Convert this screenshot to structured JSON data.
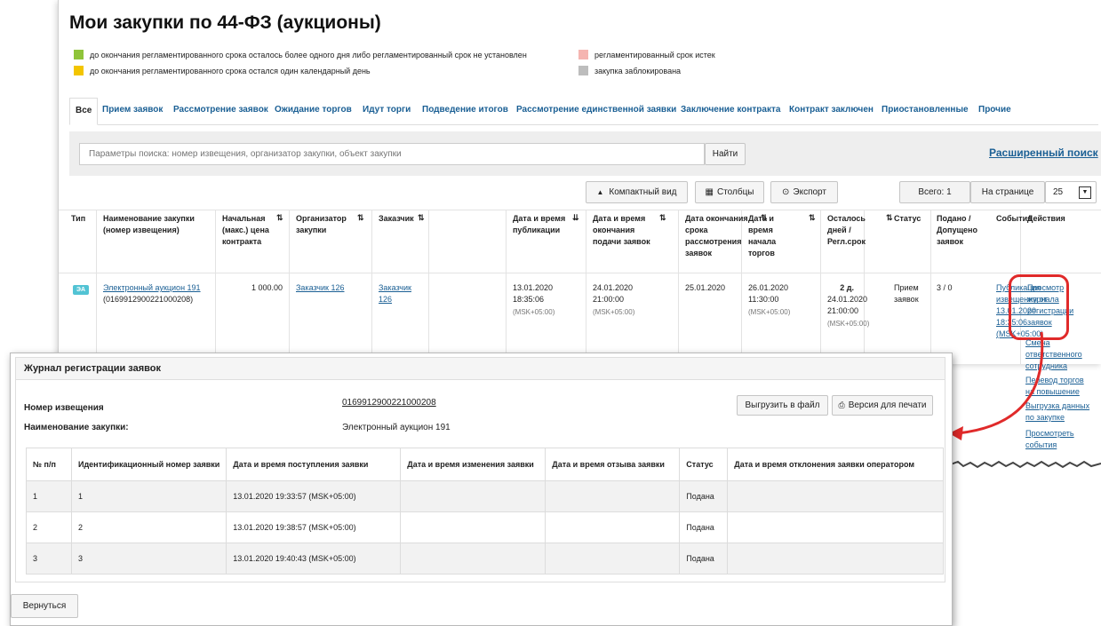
{
  "page": {
    "title": "Мои закупки по 44-ФЗ (аукционы)",
    "legend": [
      {
        "color": "#8fc43a",
        "text": "до окончания регламентированного срока осталось более одного дня либо регламентированный срок не установлен"
      },
      {
        "color": "#f3c500",
        "text": "до окончания регламентированного срока остался один календарный день"
      },
      {
        "color": "#f5b5b1",
        "text": "регламентированный срок истек"
      },
      {
        "color": "#bdbdbd",
        "text": "закупка заблокирована"
      }
    ],
    "tabs": [
      "Все",
      "Прием заявок",
      "Рассмотрение заявок",
      "Ожидание торгов",
      "Идут торги",
      "Подведение итогов",
      "Рассмотрение единственной заявки",
      "Заключение контракта",
      "Контракт заключен",
      "Приостановленные",
      "Прочие"
    ],
    "search": {
      "placeholder": "Параметры поиска: номер извещения, организатор закупки, объект закупки",
      "button": "Найти",
      "advanced": "Расширенный поиск"
    },
    "toolbar": {
      "compact": "Компактный вид",
      "columns": "Столбцы",
      "export": "Экспорт",
      "total": "Всего: 1",
      "per_page_label": "На странице",
      "per_page_value": "25"
    },
    "columns": {
      "type": "Тип",
      "name": "Наименование закупки (номер извещения)",
      "price": "Начальная (макс.) цена контракта",
      "organizer": "Организатор закупки",
      "customer": "Заказчик",
      "pub_date": "Дата и время публикации",
      "end_date": "Дата и время окончания подачи заявок",
      "review_date": "Дата окончания срока рассмотрения заявок",
      "start_date": "Дата и время начала торгов",
      "remaining": "Осталось дней / Регл.срок",
      "status": "Статус",
      "submitted": "Подано / Допущено заявок",
      "events": "События",
      "actions": "Действия"
    },
    "sort_icon": "⇅",
    "sort_icon_active": "⇊",
    "row": {
      "type_badge": "ЭА",
      "name": "Электронный аукцион 191",
      "notice": "(0169912900221000208)",
      "price": "1 000.00",
      "organizer": "Заказчик 126",
      "customer_1": "Заказчик",
      "customer_2": "126",
      "pub_date": "13.01.2020",
      "pub_time": "18:35:06",
      "pub_tz": "(MSK+05:00)",
      "end_date": "24.01.2020",
      "end_time": "21:00:00",
      "end_tz": "(MSK+05:00)",
      "review_date": "25.01.2020",
      "start_date": "26.01.2020",
      "start_time": "11:30:00",
      "start_tz": "(MSK+05:00)",
      "remaining_days": "2 д.",
      "remaining_date": "24.01.2020",
      "remaining_time": "21:00:00",
      "remaining_tz": "(MSK+05:00)",
      "status_1": "Прием",
      "status_2": "заявок",
      "submitted": "3 / 0",
      "event_lines": [
        "Публикация",
        "извещения от",
        "13.01.2020",
        "18:35:06",
        "(MSK+05:00)"
      ],
      "action_view_lines": [
        "Просмотр",
        "журнала",
        "регистрации",
        "заявок"
      ],
      "action_others": [
        [
          "Смена",
          "ответственного",
          "сотрудника"
        ],
        [
          "Перевод торгов",
          "на повышение"
        ],
        [
          "Выгрузка данных",
          "по закупке"
        ],
        [
          "Просмотреть",
          "события"
        ]
      ]
    }
  },
  "modal": {
    "title": "Журнал регистрации заявок",
    "notice_label": "Номер извещения",
    "notice_value": "0169912900221000208",
    "name_label": "Наименование закупки:",
    "name_value": "Электронный аукцион 191",
    "export_button": "Выгрузить в файл",
    "print_button": "Версия для печати",
    "columns": [
      "№ п/п",
      "Идентификационный номер заявки",
      "Дата и время поступления заявки",
      "Дата и время изменения заявки",
      "Дата и время отзыва заявки",
      "Статус",
      "Дата и время отклонения заявки оператором"
    ],
    "rows": [
      {
        "n": "1",
        "id": "1",
        "received": "13.01.2020 19:33:57 (MSK+05:00)",
        "changed": "",
        "withdrawn": "",
        "status": "Подана",
        "rejected": ""
      },
      {
        "n": "2",
        "id": "2",
        "received": "13.01.2020 19:38:57 (MSK+05:00)",
        "changed": "",
        "withdrawn": "",
        "status": "Подана",
        "rejected": ""
      },
      {
        "n": "3",
        "id": "3",
        "received": "13.01.2020 19:40:43 (MSK+05:00)",
        "changed": "",
        "withdrawn": "",
        "status": "Подана",
        "rejected": ""
      }
    ],
    "back_button": "Вернуться"
  },
  "colors": {
    "link": "#1a5f94",
    "callout": "#e02a2a",
    "badge": "#52c3d4"
  }
}
